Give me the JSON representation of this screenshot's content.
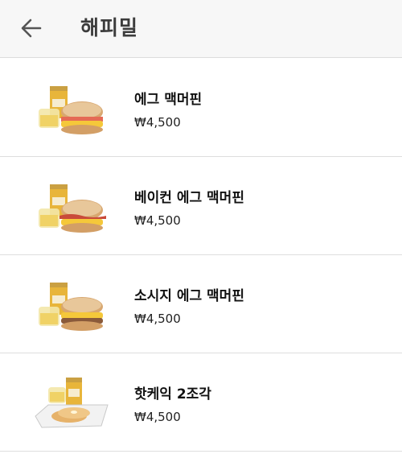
{
  "header": {
    "title": "해피밀",
    "back_icon": "arrow-left-icon"
  },
  "menu": {
    "items": [
      {
        "name": "에그 맥머핀",
        "price": "₩4,500",
        "image": "egg-mcmuffin-set"
      },
      {
        "name": "베이컨 에그 맥머핀",
        "price": "₩4,500",
        "image": "bacon-egg-mcmuffin-set"
      },
      {
        "name": "소시지 에그 맥머핀",
        "price": "₩4,500",
        "image": "sausage-egg-mcmuffin-set"
      },
      {
        "name": "핫케익 2조각",
        "price": "₩4,500",
        "image": "hotcake-set"
      }
    ]
  },
  "colors": {
    "header_bg": "#f7f7f7",
    "divider": "#dedede",
    "juice_can": "#e8b53a",
    "muffin": "#d8a770",
    "egg": "#f5c83a"
  }
}
